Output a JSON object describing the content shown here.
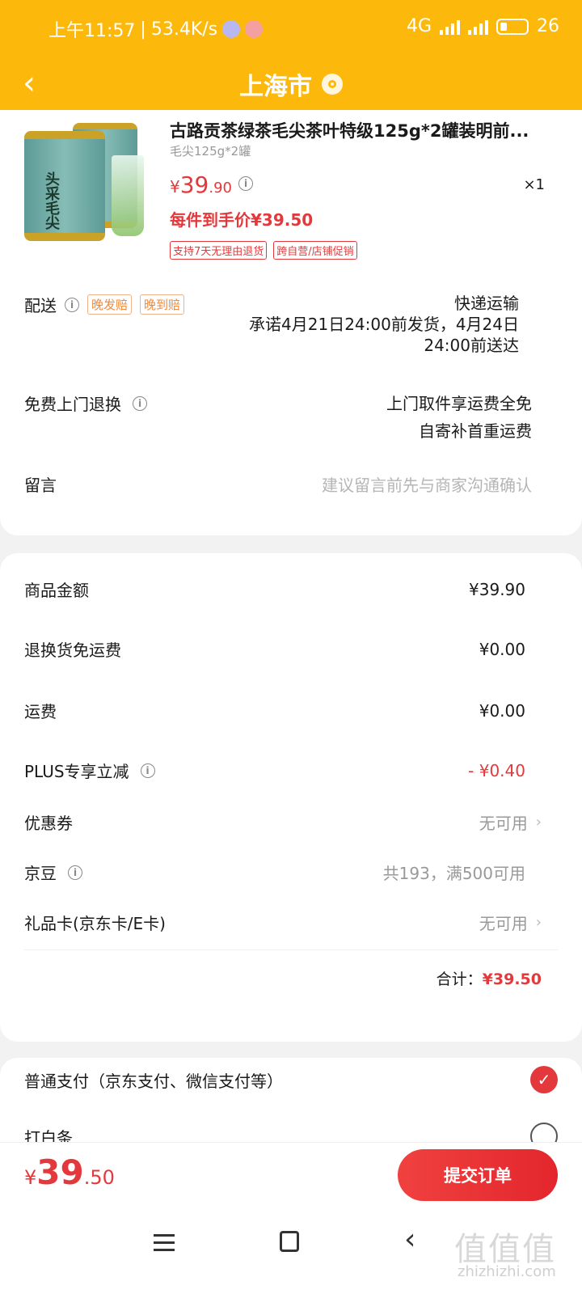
{
  "status_bar": {
    "time": "上午11:57",
    "speed": "53.4K/s",
    "network": "4G",
    "battery": "26"
  },
  "header": {
    "title": "上海市",
    "back_icon": "chevron-left-icon",
    "location_icon": "location-pin-icon"
  },
  "product": {
    "image_text": "头采毛尖",
    "name": "古路贡茶绿茶毛尖茶叶特级125g*2罐装明前...",
    "spec": "毛尖125g*2罐",
    "price_yen": "¥",
    "price_int": "39",
    "price_dec": ".90",
    "qty": "×1",
    "final_price": "每件到手价¥39.50",
    "tags": [
      "支持7天无理由退货",
      "跨自营/店铺促销"
    ]
  },
  "delivery": {
    "label": "配送",
    "tags": [
      "晚发赔",
      "晚到赔"
    ],
    "method": "快递运输",
    "promise_line1": "承诺4月21日24:00前发货，4月24日",
    "promise_line2": "24:00前送达"
  },
  "return_service": {
    "label": "免费上门退换",
    "line1": "上门取件享运费全免",
    "line2": "自寄补首重运费"
  },
  "message": {
    "label": "留言",
    "placeholder": "建议留言前先与商家沟通确认"
  },
  "summary": {
    "goods_label": "商品金额",
    "goods_value": "¥39.90",
    "return_free_label": "退换货免运费",
    "return_free_value": "¥0.00",
    "freight_label": "运费",
    "freight_value": "¥0.00",
    "plus_label": "PLUS专享立减",
    "plus_value": "- ¥0.40",
    "coupon_label": "优惠券",
    "coupon_value": "无可用",
    "jd_bean_label": "京豆",
    "jd_bean_value": "共193，满500可用",
    "gift_card_label": "礼品卡(京东卡/E卡)",
    "gift_card_value": "无可用",
    "total_label": "合计：",
    "total_value": "¥39.50"
  },
  "payment": {
    "option1": "普通支付（京东支付、微信支付等）",
    "option2": "打白条"
  },
  "bottom_bar": {
    "yen": "¥",
    "int": "39",
    "dec": ".50",
    "submit": "提交订单"
  },
  "watermark": {
    "text": "值值值",
    "sub": "zhizhizhi.com"
  },
  "colors": {
    "accent": "#fdb90b",
    "price_red": "#e4393c"
  }
}
